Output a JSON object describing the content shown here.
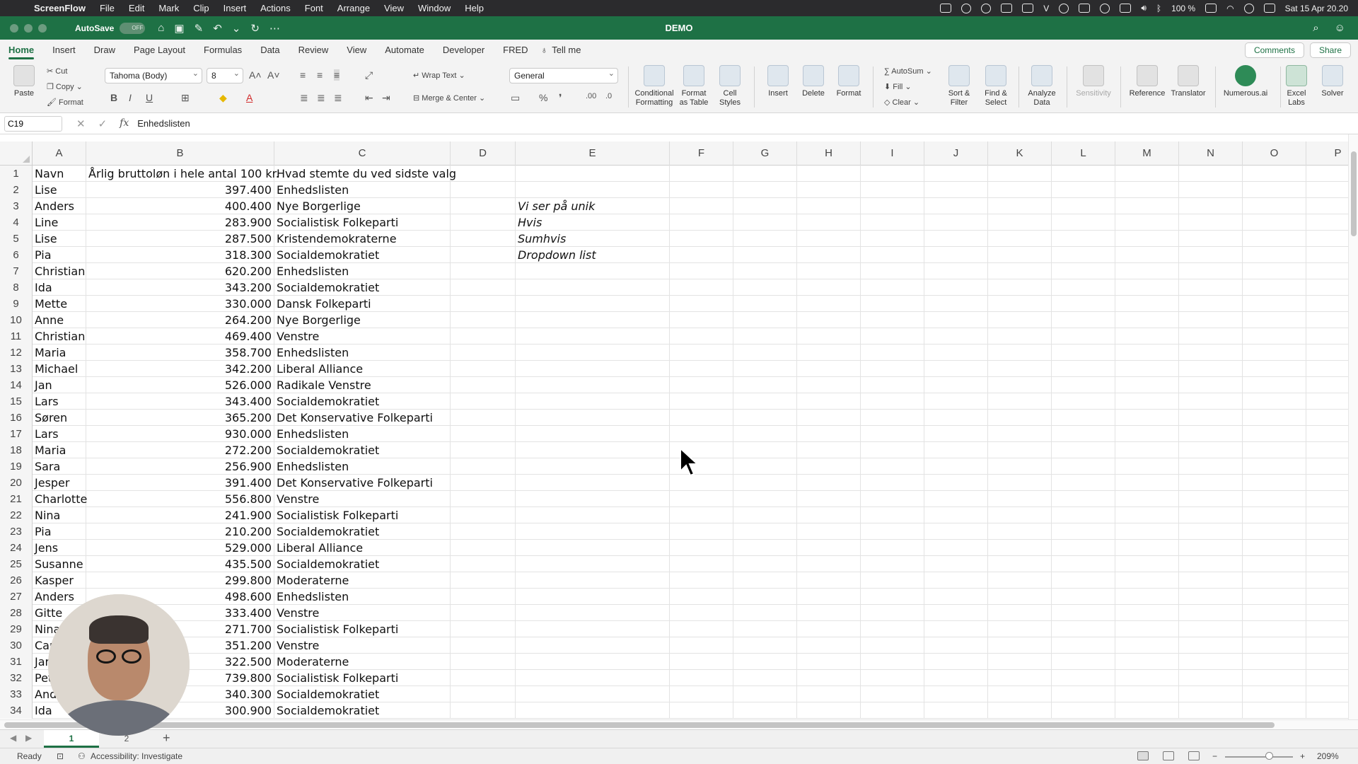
{
  "menubar": {
    "app": "ScreenFlow",
    "items": [
      "File",
      "Edit",
      "Mark",
      "Clip",
      "Insert",
      "Actions",
      "Font",
      "Arrange",
      "View",
      "Window",
      "Help"
    ],
    "battery": "100 %",
    "datetime": "Sat 15 Apr  20.20"
  },
  "titlebar": {
    "autosave": "AutoSave",
    "toggle": "OFF",
    "document": "DEMO"
  },
  "tabs": [
    "Home",
    "Insert",
    "Draw",
    "Page Layout",
    "Formulas",
    "Data",
    "Review",
    "View",
    "Automate",
    "Developer",
    "FRED"
  ],
  "tell_me": "Tell me",
  "comments": "Comments",
  "share": "Share",
  "ribbon": {
    "paste": "Paste",
    "cut": "Cut",
    "copy": "Copy",
    "format_painter": "Format",
    "font_name": "Tahoma (Body)",
    "font_size": "8",
    "wrap_text": "Wrap Text",
    "merge_center": "Merge & Center",
    "number_format": "General",
    "conditional_formatting": "Conditional Formatting",
    "format_as_table": "Format as Table",
    "cell_styles": "Cell Styles",
    "insert": "Insert",
    "delete": "Delete",
    "format": "Format",
    "autosum": "AutoSum",
    "fill": "Fill",
    "clear": "Clear",
    "sort_filter": "Sort & Filter",
    "find_select": "Find & Select",
    "analyze_data": "Analyze Data",
    "sensitivity": "Sensitivity",
    "reference": "Reference",
    "translator": "Translator",
    "numerous": "Numerous.ai",
    "excel_labs": "Excel Labs",
    "solver": "Solver"
  },
  "formula_bar": {
    "name_box": "C19",
    "fx": "fx",
    "formula": "Enhedslisten"
  },
  "columns": [
    "A",
    "B",
    "C",
    "D",
    "E",
    "F",
    "G",
    "H",
    "I",
    "J",
    "K",
    "L",
    "M",
    "N",
    "O",
    "P"
  ],
  "rows": [
    {
      "n": "1",
      "a": "Navn",
      "b": "Årlig bruttoløn i hele antal 100 kr.",
      "c": "Hvad stemte du ved sidste valg",
      "e": ""
    },
    {
      "n": "2",
      "a": "Lise",
      "b": "397.400",
      "c": "Enhedslisten",
      "e": ""
    },
    {
      "n": "3",
      "a": "Anders",
      "b": "400.400",
      "c": "Nye Borgerlige",
      "e": "Vi ser på unik"
    },
    {
      "n": "4",
      "a": "Line",
      "b": "283.900",
      "c": "Socialistisk Folkeparti",
      "e": "Hvis"
    },
    {
      "n": "5",
      "a": "Lise",
      "b": "287.500",
      "c": "Kristendemokraterne",
      "e": "Sumhvis"
    },
    {
      "n": "6",
      "a": "Pia",
      "b": "318.300",
      "c": "Socialdemokratiet",
      "e": "Dropdown list"
    },
    {
      "n": "7",
      "a": "Christian",
      "b": "620.200",
      "c": "Enhedslisten",
      "e": ""
    },
    {
      "n": "8",
      "a": "Ida",
      "b": "343.200",
      "c": "Socialdemokratiet",
      "e": ""
    },
    {
      "n": "9",
      "a": "Mette",
      "b": "330.000",
      "c": "Dansk Folkeparti",
      "e": ""
    },
    {
      "n": "10",
      "a": "Anne",
      "b": "264.200",
      "c": "Nye Borgerlige",
      "e": ""
    },
    {
      "n": "11",
      "a": "Christian",
      "b": "469.400",
      "c": "Venstre",
      "e": ""
    },
    {
      "n": "12",
      "a": "Maria",
      "b": "358.700",
      "c": "Enhedslisten",
      "e": ""
    },
    {
      "n": "13",
      "a": "Michael",
      "b": "342.200",
      "c": "Liberal Alliance",
      "e": ""
    },
    {
      "n": "14",
      "a": "Jan",
      "b": "526.000",
      "c": "Radikale Venstre",
      "e": ""
    },
    {
      "n": "15",
      "a": "Lars",
      "b": "343.400",
      "c": "Socialdemokratiet",
      "e": ""
    },
    {
      "n": "16",
      "a": "Søren",
      "b": "365.200",
      "c": "Det Konservative Folkeparti",
      "e": ""
    },
    {
      "n": "17",
      "a": "Lars",
      "b": "930.000",
      "c": "Enhedslisten",
      "e": ""
    },
    {
      "n": "18",
      "a": "Maria",
      "b": "272.200",
      "c": "Socialdemokratiet",
      "e": ""
    },
    {
      "n": "19",
      "a": "Sara",
      "b": "256.900",
      "c": "Enhedslisten",
      "e": ""
    },
    {
      "n": "20",
      "a": "Jesper",
      "b": "391.400",
      "c": "Det Konservative Folkeparti",
      "e": ""
    },
    {
      "n": "21",
      "a": "Charlotte",
      "b": "556.800",
      "c": "Venstre",
      "e": ""
    },
    {
      "n": "22",
      "a": "Nina",
      "b": "241.900",
      "c": "Socialistisk Folkeparti",
      "e": ""
    },
    {
      "n": "23",
      "a": "Pia",
      "b": "210.200",
      "c": "Socialdemokratiet",
      "e": ""
    },
    {
      "n": "24",
      "a": "Jens",
      "b": "529.000",
      "c": "Liberal Alliance",
      "e": ""
    },
    {
      "n": "25",
      "a": "Susanne",
      "b": "435.500",
      "c": "Socialdemokratiet",
      "e": ""
    },
    {
      "n": "26",
      "a": "Kasper",
      "b": "299.800",
      "c": "Moderaterne",
      "e": ""
    },
    {
      "n": "27",
      "a": "Anders",
      "b": "498.600",
      "c": "Enhedslisten",
      "e": ""
    },
    {
      "n": "28",
      "a": "Gitte",
      "b": "333.400",
      "c": "Venstre",
      "e": ""
    },
    {
      "n": "29",
      "a": "Nina",
      "b": "271.700",
      "c": "Socialistisk Folkeparti",
      "e": ""
    },
    {
      "n": "30",
      "a": "Car",
      "b": "351.200",
      "c": "Venstre",
      "e": ""
    },
    {
      "n": "31",
      "a": "Jar",
      "b": "322.500",
      "c": "Moderaterne",
      "e": ""
    },
    {
      "n": "32",
      "a": "Pet",
      "b": "739.800",
      "c": "Socialistisk Folkeparti",
      "e": ""
    },
    {
      "n": "33",
      "a": "Ande",
      "b": "340.300",
      "c": "Socialdemokratiet",
      "e": ""
    },
    {
      "n": "34",
      "a": "Ida",
      "b": "300.900",
      "c": "Socialdemokratiet",
      "e": ""
    }
  ],
  "sheets": [
    "1",
    "2"
  ],
  "status": {
    "ready": "Ready",
    "accessibility": "Accessibility: Investigate",
    "zoom": "209%"
  },
  "colors": {
    "excel_green": "#1e7145",
    "menubar": "#2b2b2d"
  }
}
